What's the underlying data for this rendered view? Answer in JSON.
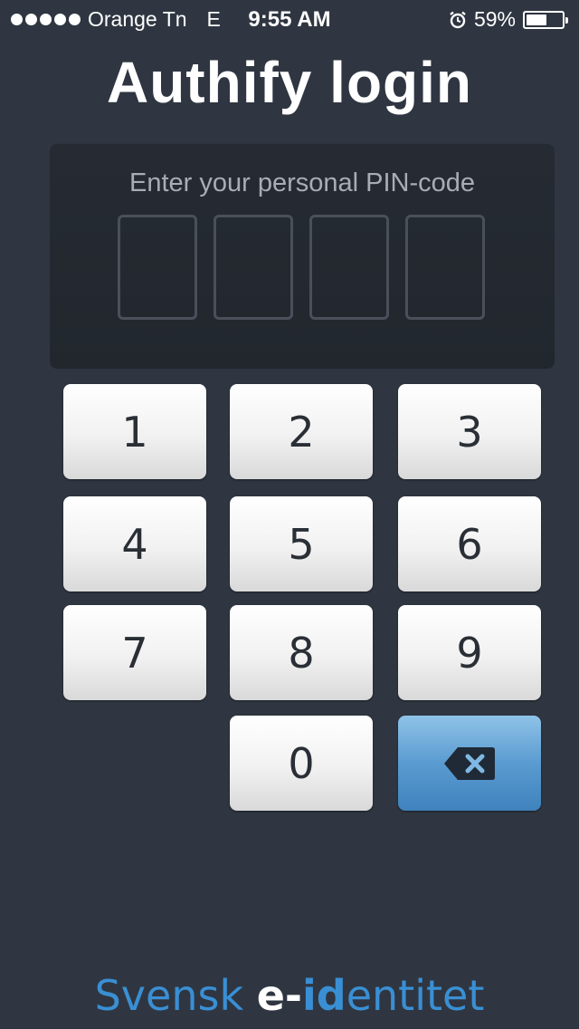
{
  "status_bar": {
    "carrier": "Orange Tn",
    "network": "E",
    "time": "9:55 AM",
    "battery_percent_label": "59%",
    "battery_level": 0.59,
    "signal_dots": 5,
    "icons": [
      "alarm-icon",
      "battery-icon"
    ]
  },
  "title": "Authify login",
  "pin": {
    "prompt": "Enter your personal PIN-code",
    "box_count": 4,
    "entered": [
      "",
      "",
      "",
      ""
    ]
  },
  "keypad": {
    "keys": [
      "1",
      "2",
      "3",
      "4",
      "5",
      "6",
      "7",
      "8",
      "9",
      "0"
    ],
    "delete_icon": "backspace-icon",
    "delete_color": "#4a8fca"
  },
  "brand": {
    "part1": "Svensk ",
    "part2": "e-",
    "part3": "id",
    "part4": "entitet"
  },
  "colors": {
    "background": "#2f3641",
    "panel": "#24292f",
    "brand_blue": "#3a8fd4"
  }
}
